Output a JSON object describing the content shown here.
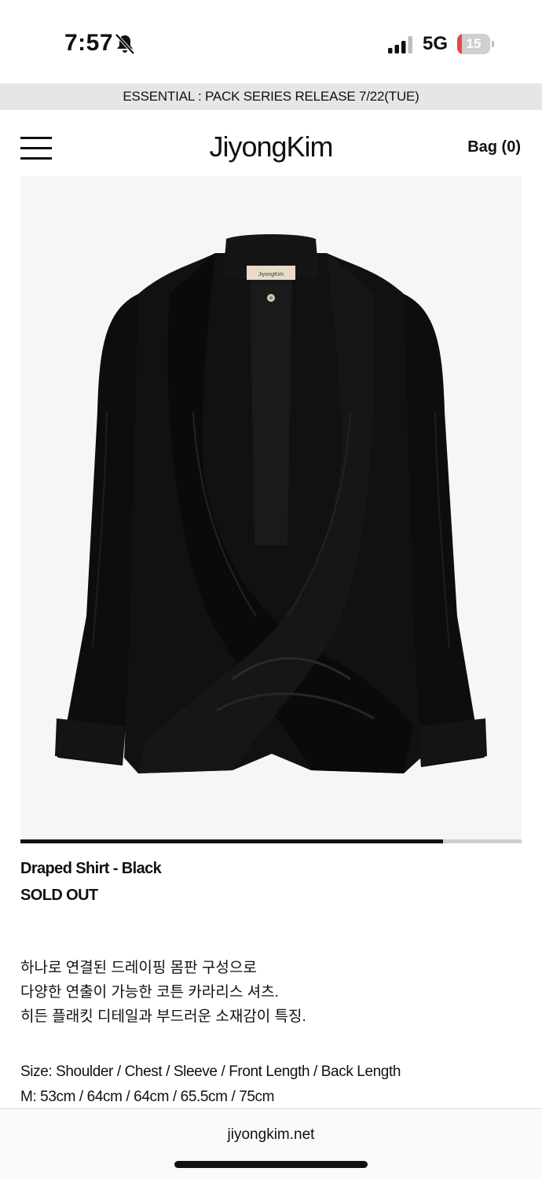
{
  "status_bar": {
    "time": "7:57",
    "network": "5G",
    "battery_level": "15",
    "battery_fraction": 0.15,
    "icons": [
      "bell-slash-icon",
      "signal-icon",
      "battery-icon"
    ]
  },
  "announcement": "ESSENTIAL : PACK SERIES RELEASE 7/22(TUE)",
  "header": {
    "menu_icon": "hamburger-menu-icon",
    "logo": "JiyongKim",
    "bag_label": "Bag (0)"
  },
  "product": {
    "label_text": "JiyongKim",
    "gallery_progress": 0.844,
    "name": "Draped Shirt - Black",
    "status": "SOLD OUT",
    "description": [
      "하나로 연결된 드레이핑 몸판 구성으로",
      "다양한 연출이 가능한 코튼 카라리스 셔츠.",
      "히든 플래킷 디테일과 부드러운 소재감이 특징."
    ],
    "size_header": "Size: Shoulder / Chest / Sleeve / Front Length / Back Length",
    "size_values": "M: 53cm / 64cm / 64cm / 65.5cm / 75cm"
  },
  "browser": {
    "url": "jiyongkim.net"
  },
  "colors": {
    "announcement_bg": "#e6e6e6",
    "gallery_bg": "#f6f6f6",
    "text": "#111111",
    "battery_low": "#e5484d"
  }
}
